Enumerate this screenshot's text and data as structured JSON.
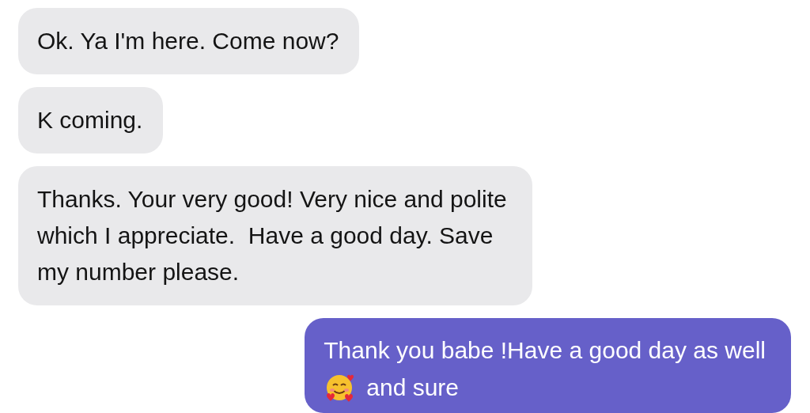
{
  "messages": [
    {
      "outgoing": false,
      "parts": [
        {
          "kind": "text",
          "text": "Ok. Ya I'm here. Come now?"
        }
      ]
    },
    {
      "outgoing": false,
      "parts": [
        {
          "kind": "text",
          "text": "K coming."
        }
      ]
    },
    {
      "outgoing": false,
      "parts": [
        {
          "kind": "text",
          "text": "Thanks. Your very good! Very nice and polite which I appreciate.  Have a good day. Save my number please."
        }
      ]
    },
    {
      "outgoing": true,
      "parts": [
        {
          "kind": "text",
          "text": "Thank you babe !Have a good day as well"
        },
        {
          "kind": "emoji"
        },
        {
          "kind": "text",
          "text": "and sure"
        }
      ]
    }
  ]
}
